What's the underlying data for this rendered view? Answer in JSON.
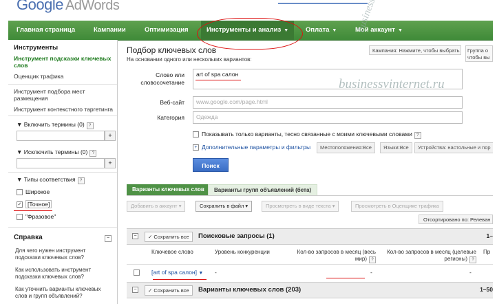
{
  "header": {
    "logo_google": "Google",
    "logo_product": "AdWords"
  },
  "nav": [
    {
      "label": "Главная страница",
      "caret": false
    },
    {
      "label": "Кампании",
      "caret": false
    },
    {
      "label": "Оптимизация",
      "caret": false
    },
    {
      "label": "Инструменты и анализ",
      "caret": true
    },
    {
      "label": "Оплата",
      "caret": true
    },
    {
      "label": "Мой аккаунт",
      "caret": true
    }
  ],
  "sidebar": {
    "tools_title": "Инструменты",
    "tools": [
      "Инструмент подсказки ключевых слов",
      "Оценщик трафика",
      "Инструмент подбора мест размещения",
      "Инструмент контекстного таргетинга"
    ],
    "include_terms": "Включить термины (0)",
    "exclude_terms": "Исключить термины (0)",
    "match_types_title": "Типы соответствия",
    "match_types": [
      {
        "label": "Широкое",
        "checked": false
      },
      {
        "label": "[Точное]",
        "checked": true
      },
      {
        "label": "\"Фразовое\"",
        "checked": false
      }
    ],
    "help_title": "Справка",
    "help_links": [
      "Для чего нужен инструмент подсказки ключевых слов?",
      "Как использовать инструмент подсказки ключевых слов?",
      "Как уточнить варианты ключевых слов и групп объявлений?"
    ],
    "plus": "+",
    "q": "?"
  },
  "main": {
    "title": "Подбор ключевых слов",
    "subtitle": "На основании одного или нескольких вариантов:",
    "tip_campaign": "Кампания: Нажмите, чтобы выбрать",
    "tip_group": "Группа о чтобы вы",
    "word_label": "Слово или словосочетание",
    "word_value": "art of spa салон",
    "site_label": "Веб-сайт",
    "site_placeholder": "www.google.com/page.html",
    "category_label": "Категория",
    "category_placeholder": "Одежда",
    "only_related": "Показывать только варианты, тесно связанные с моими ключевыми словами",
    "advanced": "Дополнительные параметры и фильтры",
    "chips": [
      "Местоположения:Все",
      "Языки:Все",
      "Устройства: настольные и пор"
    ],
    "search_button": "Поиск",
    "tabs": [
      "Варианты ключевых слов",
      "Варианты групп объявлений (бета)"
    ],
    "toolbar": [
      "Добавить в аккаунт ▾",
      "Сохранить в файл ▾",
      "Просмотреть в виде текста ▾",
      "Просмотреть в Оценщике трафика"
    ],
    "sorted": "Отсортировано по: Релеван",
    "save_all": "✓ Сохранить все",
    "section1_title": "Поисковые запросы (1)",
    "section1_range": "1–",
    "columns": [
      "Ключевое слово",
      "Уровень конкуренции",
      "Кол-во запросов в месяц (весь мир)",
      "Кол-во запросов в месяц (целевые регионы)",
      "Пр"
    ],
    "row_keyword": "[art of spa салон]",
    "row_competition": "-",
    "row_global": "-",
    "row_local": "-",
    "section2_title": "Варианты ключевых слов (203)",
    "section2_range": "1–50"
  },
  "watermarks": [
    "businessvinternet.ru",
    "businessvinternet.ru"
  ]
}
